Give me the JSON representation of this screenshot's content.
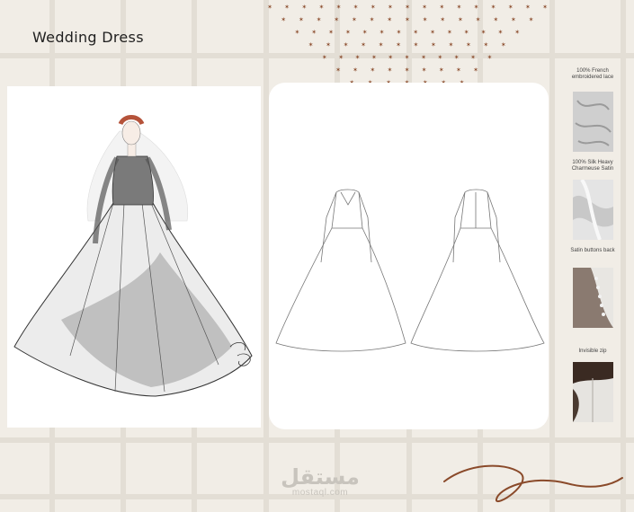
{
  "page": {
    "title": "Wedding Dress"
  },
  "colors": {
    "background": "#f1ede6",
    "grid_line": "#e3ded5",
    "accent_brown": "#8a4a2a",
    "panel": "#ffffff"
  },
  "illustration": {
    "signature": "Yasmeen Zaki"
  },
  "materials": [
    {
      "label": "100% French embroidered lace",
      "icon": "lace-swatch"
    },
    {
      "label": "100% Silk Heavy Charmeuse Satin",
      "icon": "satin-swatch"
    },
    {
      "label": "Satin buttons back",
      "icon": "buttons-swatch"
    },
    {
      "label": "Invisible zip",
      "icon": "zip-swatch"
    }
  ],
  "watermark": {
    "arabic": "مستقل",
    "latin": "mostaql.com"
  }
}
